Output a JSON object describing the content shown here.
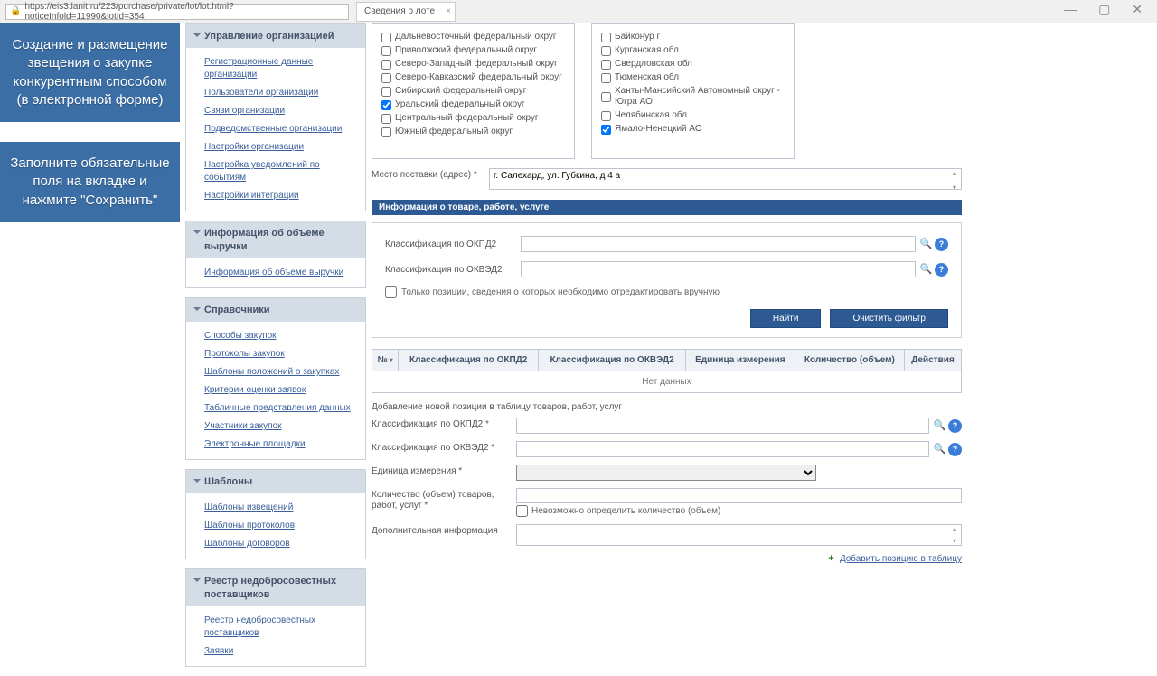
{
  "browser": {
    "url": "https://eis3.lanit.ru/223/purchase/private/lot/lot.html?noticeInfold=11990&lotId=354",
    "tab_title": "Сведения о лоте"
  },
  "left_panels": {
    "panel1": "Создание и размещение звещения о закупке конкурентным способом (в электронной форме)",
    "panel2": "Заполните обязательные поля на вкладке и нажмите \"Сохранить\""
  },
  "nav": {
    "sec1": {
      "title": "Управление организацией",
      "links": [
        "Регистрационные данные организации",
        "Пользователи организации",
        "Связи организации",
        "Подведомственные организации",
        "Настройки организации",
        "Настройка уведомлений по событиям",
        "Настройки интеграции"
      ]
    },
    "sec2": {
      "title": "Информация об объеме выручки",
      "links": [
        "Информация об объеме выручки"
      ]
    },
    "sec3": {
      "title": "Справочники",
      "links": [
        "Способы закупок",
        "Протоколы закупок",
        "Шаблоны положений о закупках",
        "Критерии оценки заявок",
        "Табличные представления данных",
        "Участники закупок",
        "Электронные площадки"
      ]
    },
    "sec4": {
      "title": "Шаблоны",
      "links": [
        "Шаблоны извещений",
        "Шаблоны протоколов",
        "Шаблоны договоров"
      ]
    },
    "sec5": {
      "title": "Реестр недобросовестных поставщиков",
      "links": [
        "Реестр недобросовестных поставщиков",
        "Заявки"
      ]
    }
  },
  "regions_left": [
    {
      "label": "Дальневосточный федеральный округ",
      "checked": false
    },
    {
      "label": "Приволжский федеральный округ",
      "checked": false
    },
    {
      "label": "Северо-Западный федеральный округ",
      "checked": false
    },
    {
      "label": "Северо-Кавказский федеральный округ",
      "checked": false
    },
    {
      "label": "Сибирский федеральный округ",
      "checked": false
    },
    {
      "label": "Уральский федеральный округ",
      "checked": true
    },
    {
      "label": "Центральный федеральный округ",
      "checked": false
    },
    {
      "label": "Южный федеральный округ",
      "checked": false
    }
  ],
  "regions_right": [
    {
      "label": "Байконур г",
      "checked": false
    },
    {
      "label": "Курганская обл",
      "checked": false
    },
    {
      "label": "Свердловская обл",
      "checked": false
    },
    {
      "label": "Тюменская обл",
      "checked": false
    },
    {
      "label": "Ханты-Мансийский Автономный округ - Югра АО",
      "checked": false
    },
    {
      "label": "Челябинская обл",
      "checked": false
    },
    {
      "label": "Ямало-Ненецкий АО",
      "checked": true
    }
  ],
  "delivery": {
    "label": "Место поставки (адрес) *",
    "value": "г. Салехард, ул. Губкина, д 4 а"
  },
  "section_product_title": "Информация о товаре, работе, услуге",
  "filter": {
    "okpd2": "Классификация по ОКПД2",
    "okved2": "Классификация по ОКВЭД2",
    "only_edit": "Только позиции, сведения о которых необходимо отредактировать вручную",
    "find": "Найти",
    "clear": "Очистить фильтр"
  },
  "table": {
    "cols": [
      "№",
      "Классификация по ОКПД2",
      "Классификация по ОКВЭД2",
      "Единица измерения",
      "Количество (объем)",
      "Действия"
    ],
    "empty": "Нет данных"
  },
  "add_section": {
    "title": "Добавление новой позиции в таблицу товаров, работ, услуг",
    "okpd2": "Классификация по ОКПД2 *",
    "okved2": "Классификация по ОКВЭД2 *",
    "unit": "Единица измерения *",
    "qty": "Количество (объем) товаров, работ, услуг *",
    "qty_na": "Невозможно определить количество (объем)",
    "extra": "Дополнительная информация",
    "add_link": "Добавить позицию в таблицу"
  }
}
